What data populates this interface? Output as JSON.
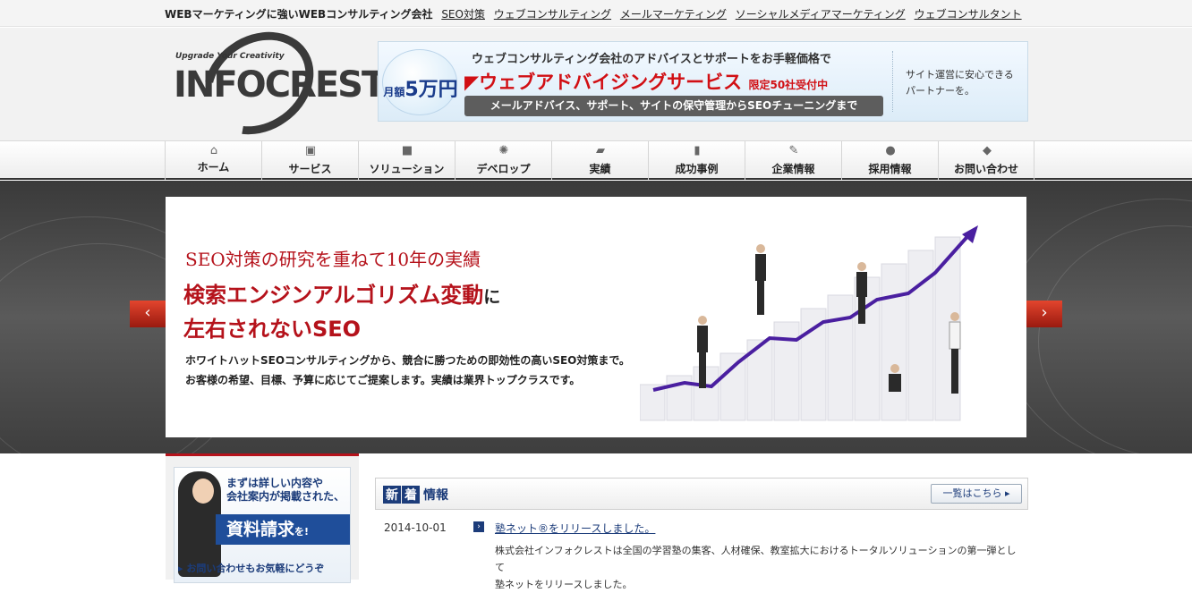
{
  "topbar": {
    "lead": "WEBマーケティングに強いWEBコンサルティング会社",
    "links": [
      "SEO対策",
      "ウェブコンサルティング",
      "メールマーケティング",
      "ソーシャルメディアマーケティング",
      "ウェブコンサルタント"
    ]
  },
  "logo": {
    "tagline": "Upgrade Your Creativity",
    "wordmark": "INFOCREST"
  },
  "banner": {
    "price_prefix": "月額",
    "price": "5万円",
    "line1": "ウェブコンサルティング会社のアドバイスとサポートをお手軽価格で",
    "line2": "ウェブアドバイジングサービス",
    "line2_note": "限定50社受付中",
    "line3": "メールアドバイス、サポート、サイトの保守管理からSEOチューニングまで",
    "side1": "サイト運営に安心できる",
    "side2": "パートナーを。"
  },
  "nav": {
    "items": [
      {
        "label": "ホーム",
        "icon": "home-icon"
      },
      {
        "label": "サービス",
        "icon": "service-icon"
      },
      {
        "label": "ソリューション",
        "icon": "solution-icon"
      },
      {
        "label": "デベロップ",
        "icon": "develop-icon"
      },
      {
        "label": "実績",
        "icon": "briefcase-icon"
      },
      {
        "label": "成功事例",
        "icon": "book-icon"
      },
      {
        "label": "企業情報",
        "icon": "pen-icon"
      },
      {
        "label": "採用情報",
        "icon": "person-icon"
      },
      {
        "label": "お問い合わせ",
        "icon": "mail-icon"
      }
    ]
  },
  "hero": {
    "headline": "SEO対策の研究を重ねて10年の実績",
    "title_a": "検索エンジンアルゴリズム変動",
    "title_a_suffix": "に",
    "title_b": "左右されないSEO",
    "desc1": "ホワイトハットSEOコンサルティングから、競合に勝つための即効性の高いSEO対策まで。",
    "desc2": "お客様の希望、目標、予算に応じてご提案します。実績は業界トップクラスです。",
    "prev": "‹",
    "next": "›"
  },
  "sidebar": {
    "t1a": "まずは詳しい内容や",
    "t1b": "会社案内が掲載された、",
    "cta": "資料請求",
    "cta_suffix": "を!",
    "contact": "お問い合わせもお気軽にどうぞ"
  },
  "news": {
    "heading_chars": [
      "新",
      "着",
      "情報"
    ],
    "more": "一覧はこちら ▸",
    "items": [
      {
        "date": "2014-10-01",
        "title": "塾ネット®をリリースしました。",
        "body1": "株式会社インフォクレストは全国の学習塾の集客、人材確保、教室拡大におけるトータルソリューションの第一弾として",
        "body2": "塾ネットをリリースしました。"
      }
    ]
  }
}
